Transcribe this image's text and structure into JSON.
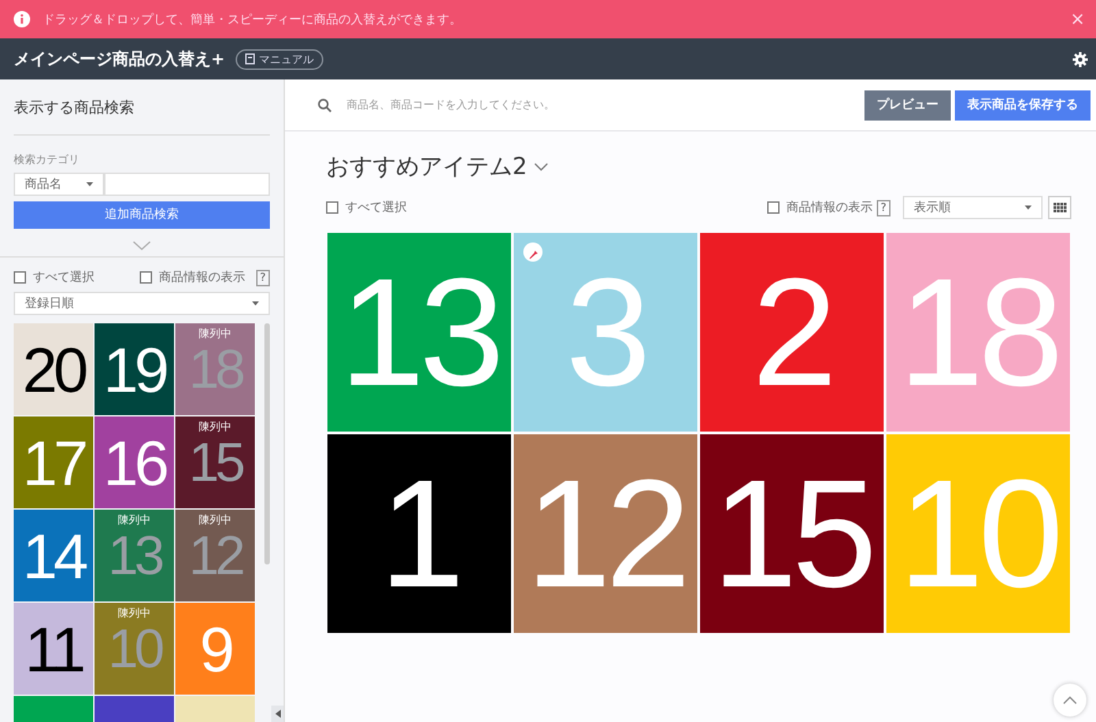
{
  "banner": {
    "message": "ドラッグ＆ドロップして、簡単・スピーディーに商品の入替えができます。",
    "close": "×"
  },
  "header": {
    "title": "メインページ商品の入替え+",
    "manual_button": "マニュアル"
  },
  "sidebar": {
    "title": "表示する商品検索",
    "category_label": "検索カテゴリ",
    "category_select": "商品名",
    "search_button": "追加商品検索",
    "select_all": {
      "label": "すべて選択",
      "checked": false
    },
    "show_info": {
      "label": "商品情報の表示",
      "checked": false
    },
    "help": "?",
    "sort_select": "登録日順",
    "products": [
      {
        "number": "20",
        "color": "#e9e1d8",
        "displayed": false
      },
      {
        "number": "19",
        "color": "#00463f",
        "displayed": false
      },
      {
        "number": "18",
        "color": "#9b7189",
        "displayed": true,
        "badge": "陳列中"
      },
      {
        "number": "17",
        "color": "#7b7a00",
        "displayed": false
      },
      {
        "number": "16",
        "color": "#a1419f",
        "displayed": false
      },
      {
        "number": "15",
        "color": "#5b1a2a",
        "displayed": true,
        "badge": "陳列中"
      },
      {
        "number": "14",
        "color": "#0b72ba",
        "displayed": false
      },
      {
        "number": "13",
        "color": "#1f7a4f",
        "displayed": true,
        "badge": "陳列中"
      },
      {
        "number": "12",
        "color": "#735a51",
        "displayed": true,
        "badge": "陳列中"
      },
      {
        "number": "11",
        "color": "#c5b9dc",
        "displayed": false
      },
      {
        "number": "10",
        "color": "#8b7b22",
        "displayed": true,
        "badge": "陳列中"
      },
      {
        "number": "9",
        "color": "#ff7f1b",
        "displayed": false
      },
      {
        "color": "#00a651"
      },
      {
        "color": "#4a3fc1"
      },
      {
        "color": "#efe4b3"
      }
    ]
  },
  "main": {
    "search": {
      "placeholder": "商品名、商品コードを入力してください。"
    },
    "preview_button": "プレビュー",
    "save_button": "表示商品を保存する",
    "section_title": "おすすめアイテム2",
    "select_all": {
      "label": "すべて選択",
      "checked": false
    },
    "show_info": {
      "label": "商品情報の表示",
      "checked": false
    },
    "help": "?",
    "sort_select": "表示順",
    "products": [
      {
        "number": "13",
        "color": "#00a651",
        "pinned": false
      },
      {
        "number": "3",
        "color": "#99d5e6",
        "pinned": true
      },
      {
        "number": "2",
        "color": "#ec1c24",
        "pinned": false
      },
      {
        "number": "18",
        "color": "#f7a8c4",
        "pinned": false
      },
      {
        "number": "1",
        "color": "#000000",
        "pinned": false
      },
      {
        "number": "12",
        "color": "#b07a58",
        "pinned": false
      },
      {
        "number": "15",
        "color": "#7b0010",
        "pinned": false
      },
      {
        "number": "10",
        "color": "#ffcb05",
        "pinned": false
      }
    ]
  }
}
